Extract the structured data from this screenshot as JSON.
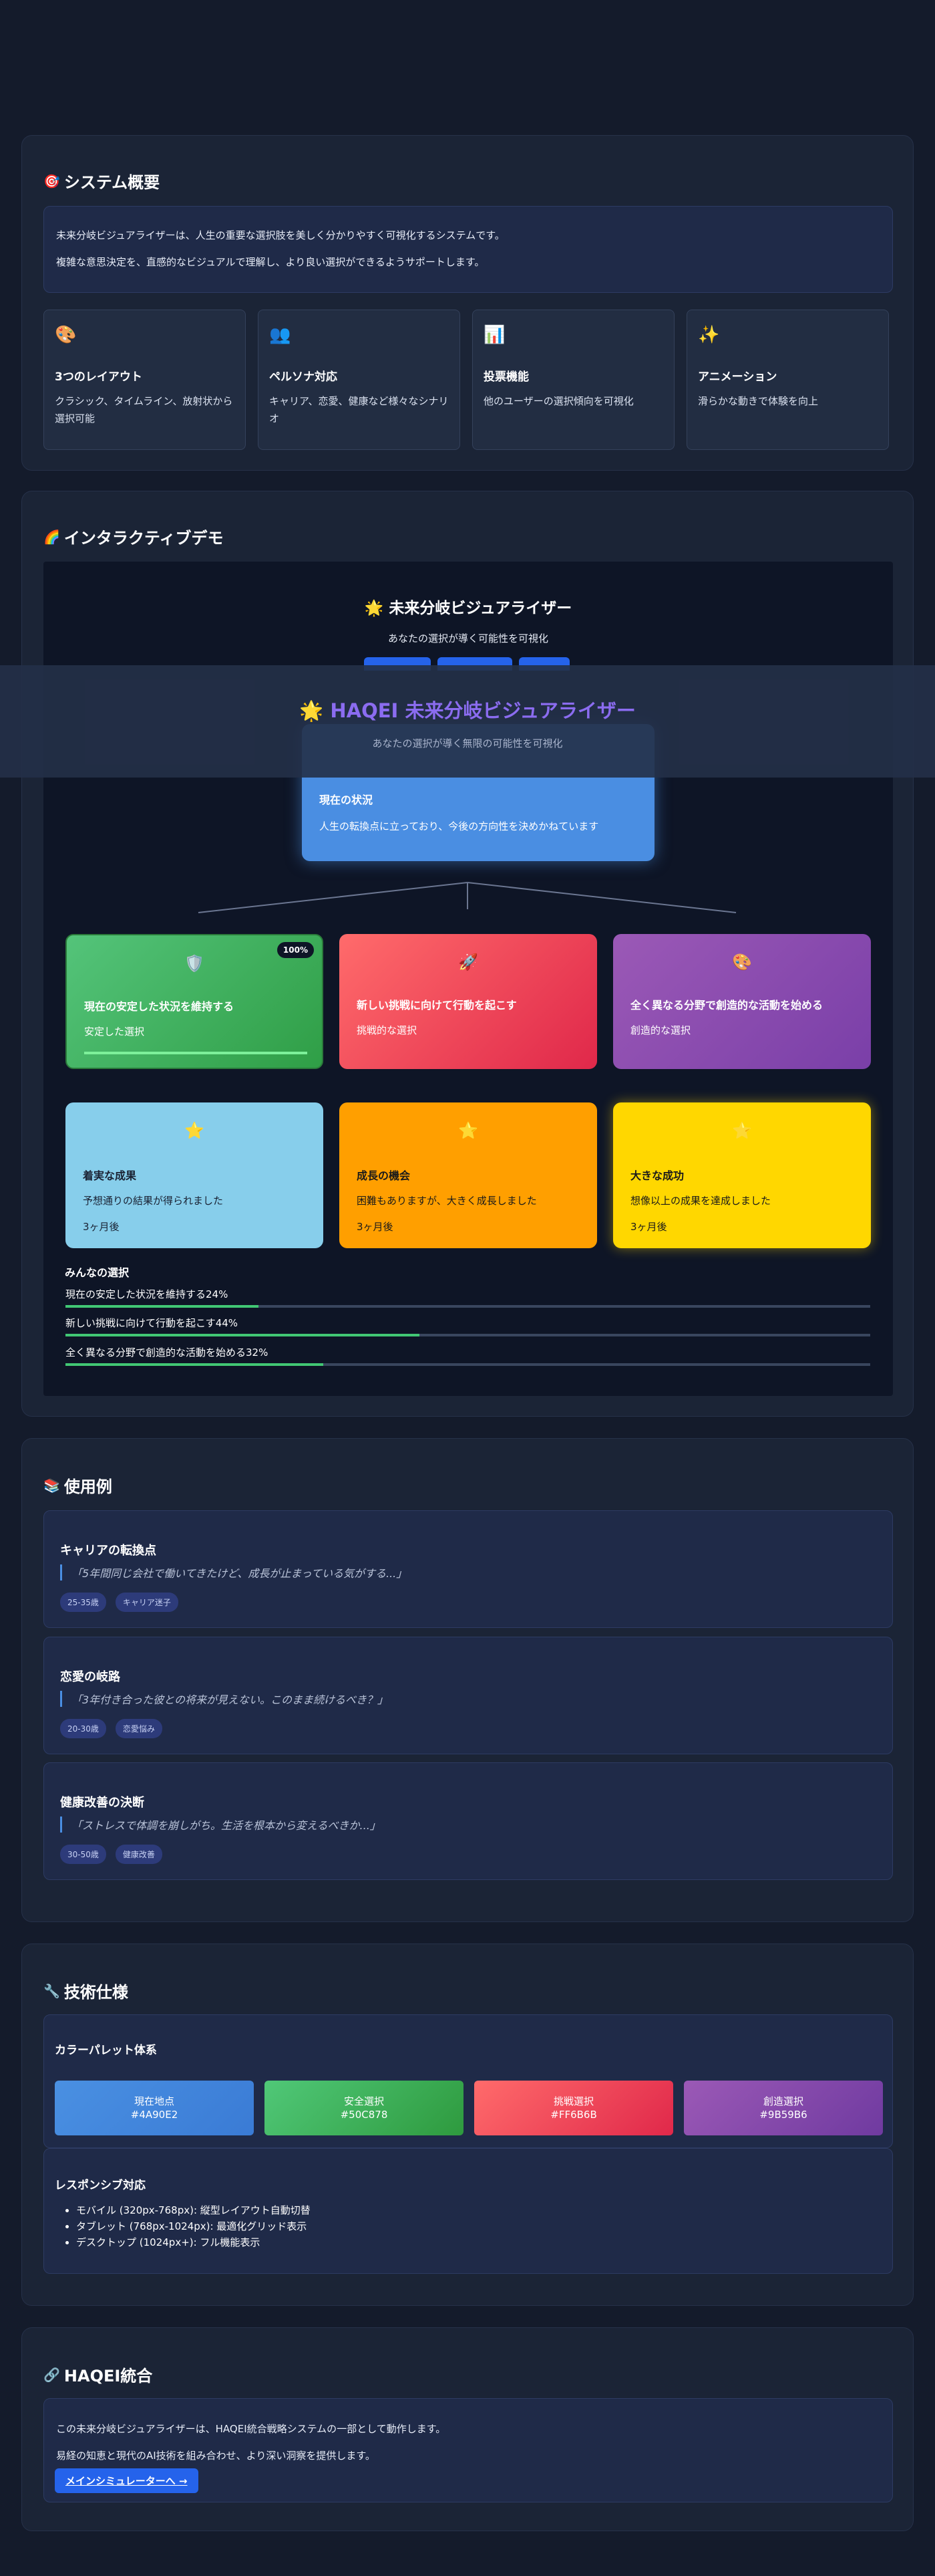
{
  "overview": {
    "icon": "🎯",
    "title": "システム概要",
    "intro_lines": [
      "未来分岐ビジュアライザーは、人生の重要な選択肢を美しく分かりやすく可視化するシステムです。",
      "複雑な意思決定を、直感的なビジュアルで理解し、より良い選択ができるようサポートします。"
    ],
    "features": [
      {
        "icon": "🎨",
        "title": "3つのレイアウト",
        "desc": "クラシック、タイムライン、放射状から選択可能"
      },
      {
        "icon": "👥",
        "title": "ペルソナ対応",
        "desc": "キャリア、恋愛、健康など様々なシナリオ"
      },
      {
        "icon": "📊",
        "title": "投票機能",
        "desc": "他のユーザーの選択傾向を可視化"
      },
      {
        "icon": "✨",
        "title": "アニメーション",
        "desc": "滑らかな動きで体験を向上"
      }
    ]
  },
  "demo": {
    "icon": "🌈",
    "title": "インタラクティブデモ",
    "inner_title_icon": "🌟",
    "inner_title": "未来分岐ビジュアライザー",
    "inner_subtitle": "あなたの選択が導く可能性を可視化",
    "overlay_title_icon": "🌟",
    "overlay_title": "HAQEI 未来分岐ビジュアライザー",
    "overlay_subtitle": "あなたの選択が導く無限の可能性を可視化",
    "current": {
      "title": "現在の状況",
      "desc": "人生の転換点に立っており、今後の方向性を決めかねています"
    },
    "choices": [
      {
        "icon": "🛡️",
        "title": "現在の安定した状況を維持する",
        "sub": "安定した選択",
        "badge": "100%",
        "progress": 100,
        "color_from": "#54c47a",
        "color_to": "#2f9e46"
      },
      {
        "icon": "🚀",
        "title": "新しい挑戦に向けて行動を起こす",
        "sub": "挑戦的な選択",
        "color_from": "#ff6b6b",
        "color_to": "#e0284a"
      },
      {
        "icon": "🎨",
        "title": "全く異なる分野で創造的な活動を始める",
        "sub": "創造的な選択",
        "color_from": "#9b59b6",
        "color_to": "#7a3fa8"
      }
    ],
    "outcomes": [
      {
        "icon": "⭐",
        "title": "着実な成果",
        "desc": "予想通りの結果が得られました",
        "time": "3ヶ月後",
        "color": "#87ceeb",
        "text_color": "#1a2233"
      },
      {
        "icon": "⭐",
        "title": "成長の機会",
        "desc": "困難もありますが、大きく成長しました",
        "time": "3ヶ月後",
        "color": "#ff9f00",
        "text_color": "#1a1a1a"
      },
      {
        "icon": "⭐",
        "title": "大きな成功",
        "desc": "想像以上の成果を達成しました",
        "time": "3ヶ月後",
        "color": "#ffd700",
        "text_color": "#1a1a1a"
      }
    ],
    "stats_title": "みんなの選択",
    "stats": [
      {
        "label": "現在の安定した状況を維持する24%",
        "percent": 24
      },
      {
        "label": "新しい挑戦に向けて行動を起こす44%",
        "percent": 44
      },
      {
        "label": "全く異なる分野で創造的な活動を始める32%",
        "percent": 32
      }
    ]
  },
  "usecases": {
    "icon": "📚",
    "title": "使用例",
    "items": [
      {
        "title": "キャリアの転換点",
        "quote": "「5年間同じ会社で働いてきたけど、成長が止まっている気がする...」",
        "tags": [
          "25-35歳",
          "キャリア迷子"
        ]
      },
      {
        "title": "恋愛の岐路",
        "quote": "「3年付き合った彼との将来が見えない。このまま続けるべき？」",
        "tags": [
          "20-30歳",
          "恋愛悩み"
        ]
      },
      {
        "title": "健康改善の決断",
        "quote": "「ストレスで体調を崩しがち。生活を根本から変えるべきか...」",
        "tags": [
          "30-50歳",
          "健康改善"
        ]
      }
    ]
  },
  "tech": {
    "icon": "🔧",
    "title": "技術仕様",
    "palette_title": "カラーパレット体系",
    "palette": [
      {
        "name": "現在地点",
        "hex": "#4A90E2",
        "color_from": "#4a90e2",
        "color_to": "#3a7bd5"
      },
      {
        "name": "安全選択",
        "hex": "#50C878",
        "color_from": "#50c878",
        "color_to": "#2e9a3e"
      },
      {
        "name": "挑戦選択",
        "hex": "#FF6B6B",
        "color_from": "#ff6b6b",
        "color_to": "#e0284a"
      },
      {
        "name": "創造選択",
        "hex": "#9B59B6",
        "color_from": "#9b59b6",
        "color_to": "#6f3aa0"
      }
    ],
    "responsive_title": "レスポンシブ対応",
    "responsive_items": [
      "モバイル (320px-768px): 縦型レイアウト自動切替",
      "タブレット (768px-1024px): 最適化グリッド表示",
      "デスクトップ (1024px+): フル機能表示"
    ]
  },
  "integration": {
    "icon": "🔗",
    "title": "HAQEI統合",
    "lines": [
      "この未来分岐ビジュアライザーは、HAQEI統合戦略システムの一部として動作します。",
      "易経の知恵と現代のAI技術を組み合わせ、より深い洞察を提供します。"
    ],
    "button": "メインシミュレーターへ →"
  }
}
